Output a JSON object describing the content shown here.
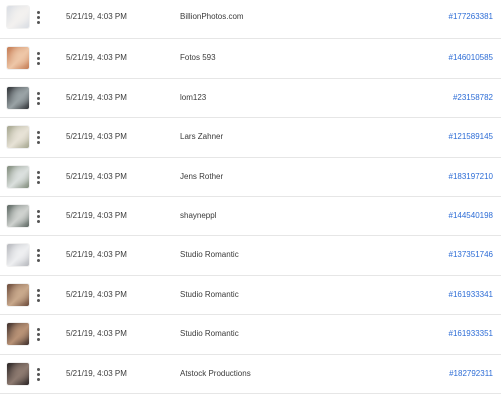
{
  "rows": [
    {
      "date": "5/21/19, 4:03 PM",
      "contributor": "BillionPhotos.com",
      "asset_id": "#177263381",
      "thumb_colors": [
        "#d9dde3",
        "#f3f1ef"
      ],
      "thumb_icon": "photo-thumbnail-icon"
    },
    {
      "date": "5/21/19, 4:03 PM",
      "contributor": "Fotos 593",
      "asset_id": "#146010585",
      "thumb_colors": [
        "#c47a52",
        "#eec7a8"
      ],
      "thumb_icon": "photo-thumbnail-icon"
    },
    {
      "date": "5/21/19, 4:03 PM",
      "contributor": "lom123",
      "asset_id": "#23158782",
      "thumb_colors": [
        "#2f3236",
        "#9aa3a6"
      ],
      "thumb_icon": "photo-thumbnail-icon"
    },
    {
      "date": "5/21/19, 4:03 PM",
      "contributor": "Lars Zahner",
      "asset_id": "#121589145",
      "thumb_colors": [
        "#a4a58e",
        "#e7e2d6"
      ],
      "thumb_icon": "photo-thumbnail-icon"
    },
    {
      "date": "5/21/19, 4:03 PM",
      "contributor": "Jens Rother",
      "asset_id": "#183197210",
      "thumb_colors": [
        "#7f8a7a",
        "#dbe0de"
      ],
      "thumb_icon": "photo-thumbnail-icon"
    },
    {
      "date": "5/21/19, 4:03 PM",
      "contributor": "shayneppl",
      "asset_id": "#144540198",
      "thumb_colors": [
        "#5a6560",
        "#cfd2cf"
      ],
      "thumb_icon": "photo-thumbnail-icon"
    },
    {
      "date": "5/21/19, 4:03 PM",
      "contributor": "Studio Romantic",
      "asset_id": "#137351746",
      "thumb_colors": [
        "#b6b8bd",
        "#eeeff1"
      ],
      "thumb_icon": "photo-thumbnail-icon"
    },
    {
      "date": "5/21/19, 4:03 PM",
      "contributor": "Studio Romantic",
      "asset_id": "#161933341",
      "thumb_colors": [
        "#6b4a3a",
        "#c9a98c"
      ],
      "thumb_icon": "photo-thumbnail-icon"
    },
    {
      "date": "5/21/19, 4:03 PM",
      "contributor": "Studio Romantic",
      "asset_id": "#161933351",
      "thumb_colors": [
        "#3d2e2a",
        "#b89276"
      ],
      "thumb_icon": "photo-thumbnail-icon"
    },
    {
      "date": "5/21/19, 4:03 PM",
      "contributor": "Atstock Productions",
      "asset_id": "#182792311",
      "thumb_colors": [
        "#2a2424",
        "#8d7a70"
      ],
      "thumb_icon": "photo-thumbnail-icon"
    }
  ],
  "row_menu_icon": "more-vertical-icon",
  "link_color": "#2c6cd6"
}
